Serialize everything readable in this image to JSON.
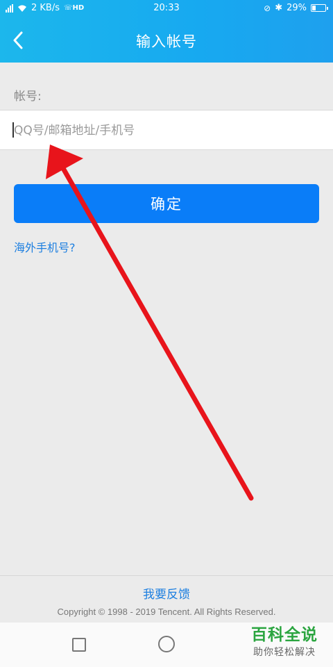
{
  "status_bar": {
    "speed": "2 KB/s",
    "hd": "HD",
    "time": "20:33",
    "battery": "29%",
    "battery_level": 0.29
  },
  "header": {
    "title": "输入帐号",
    "back_icon": "chevron-left-icon"
  },
  "form": {
    "account_label": "帐号:",
    "account_placeholder": "QQ号/邮箱地址/手机号",
    "account_value": ""
  },
  "confirm_label": "确定",
  "overseas_link": "海外手机号?",
  "footer": {
    "feedback_label": "我要反馈",
    "copyright": "Copyright © 1998 - 2019 Tencent. All Rights Reserved."
  },
  "watermark": {
    "title": "百科全说",
    "subtitle": "助你轻松解决"
  },
  "colors": {
    "header": "#17a9f0",
    "primary_button": "#0a7df8",
    "link": "#1d7fe0",
    "annotation_arrow": "#e8141b"
  }
}
